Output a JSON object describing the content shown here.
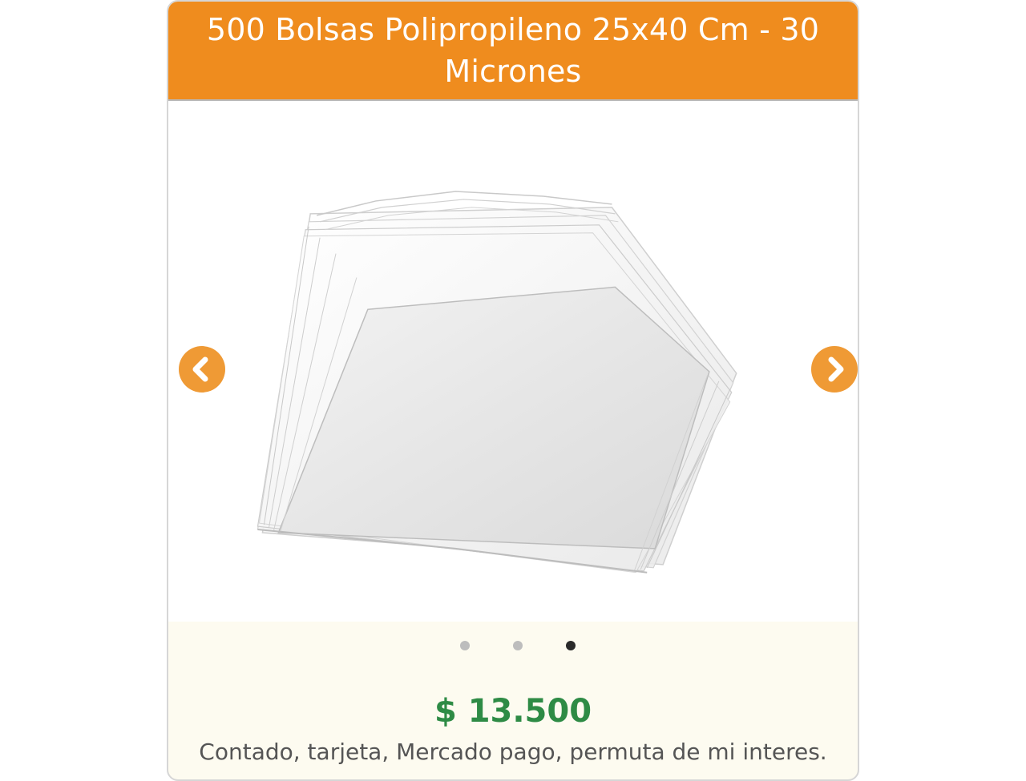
{
  "product": {
    "title": "500 Bolsas Polipropileno 25x40 Cm - 30 Micrones",
    "price": "$ 13.500",
    "payment_methods": "Contado, tarjeta, Mercado pago, permuta de mi interes."
  },
  "carousel": {
    "image_subject": "stack of clear polypropylene bags",
    "prev_icon": "chevron-left-icon",
    "next_icon": "chevron-right-icon",
    "total_slides": 3,
    "active_slide": 3
  },
  "colors": {
    "header": "#ef8c1e",
    "header_text": "#ffffff",
    "nav_button": "#ef9a35",
    "price": "#2e8b45",
    "card_background": "#fdfbf0",
    "dot_inactive": "#bdbdbd",
    "dot_active": "#2a2a2a"
  }
}
